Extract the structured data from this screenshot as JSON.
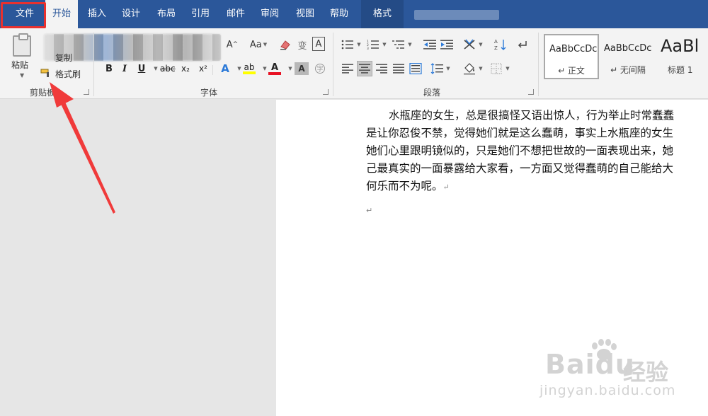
{
  "tabs": [
    {
      "label": "文件"
    },
    {
      "label": "开始"
    },
    {
      "label": "插入"
    },
    {
      "label": "设计"
    },
    {
      "label": "布局"
    },
    {
      "label": "引用"
    },
    {
      "label": "邮件"
    },
    {
      "label": "审阅"
    },
    {
      "label": "视图"
    },
    {
      "label": "帮助"
    }
  ],
  "context_tab": {
    "label": "格式"
  },
  "clipboard": {
    "paste_label": "粘贴",
    "copy_label": "复制",
    "format_painter_label": "格式刷",
    "group_label": "剪贴板"
  },
  "font": {
    "grow_label": "A",
    "case_label": "Aa",
    "phonetic_label": "变",
    "border_label": "A",
    "bold": "B",
    "italic": "I",
    "underline": "U",
    "strike": "abc",
    "subscript": "x₂",
    "superscript": "x²",
    "text_effect": "A",
    "highlight": "ab",
    "font_color": "A",
    "shade": "A",
    "group_label": "字体"
  },
  "paragraph": {
    "group_label": "段落"
  },
  "styles": [
    {
      "sample": "AaBbCcDc",
      "name": "↵ 正文"
    },
    {
      "sample": "AaBbCcDc",
      "name": "↵ 无间隔"
    },
    {
      "sample": "AaBl",
      "name": "标题 1"
    }
  ],
  "document": {
    "lines": [
      "水瓶座的女生，总是很搞怪又语出惊人，行为举止时常蠢蠢",
      "是让你忍俊不禁，觉得她们就是这么蠢萌，事实上水瓶座的女生",
      "她们心里跟明镜似的，只是她们不想把世故的一面表现出来，她",
      "己最真实的一面暴露给大家看，一方面又觉得蠢萌的自己能给大",
      "何乐而不为呢。"
    ],
    "para_mark": "↵"
  },
  "watermark": {
    "logo": "Baidu",
    "cn": "经验",
    "url": "jingyan.baidu.com"
  },
  "colors": {
    "ribbon_blue": "#2b579a",
    "highlight_red": "#e8312f",
    "font_color_red": "#e81123",
    "highlight_yellow": "#ffff00"
  }
}
